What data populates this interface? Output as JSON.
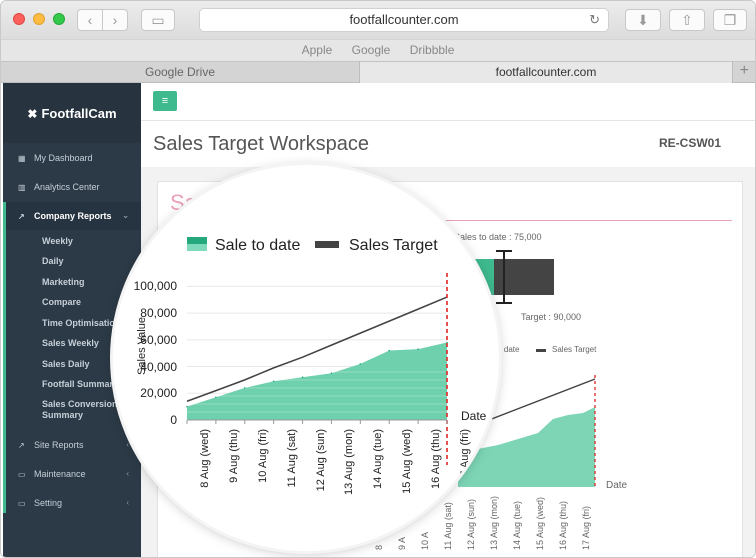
{
  "browser": {
    "url": "footfallcounter.com",
    "favorites": [
      "Apple",
      "Google",
      "Dribbble"
    ],
    "tabs": [
      "Google Drive",
      "footfallcounter.com"
    ]
  },
  "sidebar": {
    "brand": "FootfallCam",
    "items": [
      {
        "label": "My Dashboard",
        "icon": "grid-icon"
      },
      {
        "label": "Analytics Center",
        "icon": "bar-chart-icon"
      },
      {
        "label": "Company Reports",
        "icon": "line-chart-icon"
      },
      {
        "label": "Site Reports",
        "icon": "line-chart-icon"
      },
      {
        "label": "Maintenance",
        "icon": "monitor-icon"
      },
      {
        "label": "Setting",
        "icon": "monitor-icon"
      }
    ],
    "subitems": [
      "Weekly",
      "Daily",
      "Marketing",
      "Compare",
      "Time Optimisation",
      "Sales Weekly",
      "Sales Daily",
      "Footfall Summary",
      "Sales Conversion Summary"
    ]
  },
  "page": {
    "title": "Sales Target Workspace",
    "code": "RE-CSW01",
    "panel_title_fragment": "Sa"
  },
  "background_chart": {
    "sale_to_date_label": "Sales to date : 75,000",
    "target_label": "Target : 90,000",
    "legend": [
      "to date",
      "Sales Target"
    ],
    "x_labels": [
      "8",
      "9 A",
      "10 A",
      "11 Aug (sat)",
      "12 Aug (sun)",
      "13 Aug (mon)",
      "14 Aug (tue)",
      "15 Aug (wed)",
      "16 Aug (thu)",
      "17 Aug (fri)"
    ],
    "x_title": "Date"
  },
  "chart_data": {
    "type": "area",
    "legend": [
      "Sale to date",
      "Sales Target"
    ],
    "ylabel": "Sales Value",
    "xlabel": "Date",
    "ylim": [
      0,
      110000
    ],
    "y_ticks": [
      "100,000",
      "80,000",
      "60,000",
      "40,000",
      "20,000",
      "0"
    ],
    "categories": [
      "8 Aug (wed)",
      "9 Aug (thu)",
      "10 Aug (fri)",
      "11 Aug (sat)",
      "12 Aug (sun)",
      "13 Aug (mon)",
      "14 Aug (tue)",
      "15 Aug (wed)",
      "16 Aug (thu)",
      "17 Aug (fri)"
    ],
    "series": [
      {
        "name": "Sale to date",
        "values": [
          10000,
          17000,
          24000,
          29000,
          32000,
          35000,
          42000,
          52000,
          53000,
          58000
        ],
        "color": "#5ec9a6"
      },
      {
        "name": "Sales Target",
        "values": [
          14000,
          22000,
          30000,
          39000,
          47000,
          56000,
          65000,
          74000,
          83000,
          92000
        ],
        "color": "#444444"
      }
    ],
    "colors": {
      "area": "#6fd0ae",
      "line": "#444444",
      "deadline": "#e02424"
    }
  }
}
